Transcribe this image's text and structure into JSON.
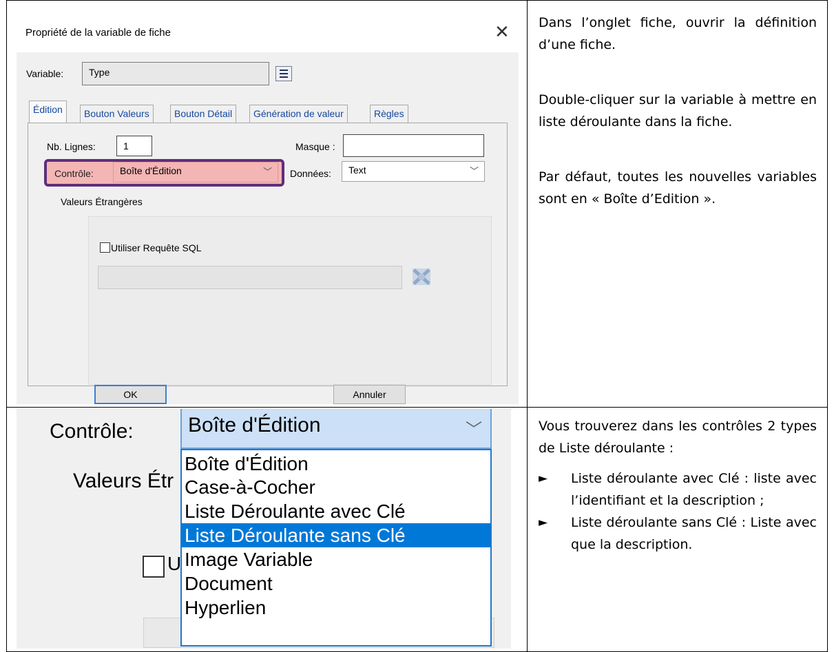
{
  "dialog": {
    "title": "Propriété de la variable de fiche",
    "close_icon": "close-icon",
    "variable_label": "Variable:",
    "variable_value": "Type",
    "tabs": [
      {
        "label": "Édition",
        "active": true
      },
      {
        "label": "Bouton Valeurs"
      },
      {
        "label": "Bouton Détail"
      },
      {
        "label": "Génération de valeur"
      },
      {
        "label": "Règles"
      }
    ],
    "nb_lignes_label": "Nb. Lignes:",
    "nb_lignes_value": "1",
    "masque_label": "Masque :",
    "masque_value": "",
    "controle_label": "Contrôle:",
    "controle_value": "Boîte d'Édition",
    "donnees_label": "Données:",
    "donnees_value": "Text",
    "valeurs_etrangeres_label": "Valeurs Étrangères",
    "utiliser_sql_label": "Utiliser Requête SQL",
    "ok_label": "OK",
    "annuler_label": "Annuler",
    "highlight_color": "#5f2e7a",
    "controle_highlight_color": "#f4b5b5"
  },
  "instructions": {
    "p1": "Dans l’onglet fiche, ouvrir la définition d’une fiche.",
    "p2": "Double-cliquer sur la variable à mettre en liste déroulante dans la fiche.",
    "p3": "Par défaut, toutes les nouvelles variables sont en « Boîte d’Edition ».",
    "p4": "Vous trouverez dans les contrôles 2 types de Liste déroulante :",
    "bullets": [
      "Liste déroulante avec Clé : liste avec l’identifiant et la description ;",
      "Liste déroulante sans Clé : Liste avec que la description."
    ],
    "bullet_glyph": "►"
  },
  "dropdown": {
    "label": "Contrôle:",
    "selected": "Boîte d'Édition",
    "partial_label": "Valeurs Étr",
    "partial_check_label": "U",
    "options": [
      "Boîte d'Édition",
      "Case-à-Cocher",
      "Liste Déroulante avec Clé",
      "Liste Déroulante sans Clé",
      "Image Variable",
      "Document",
      "Hyperlien"
    ],
    "highlighted_option": "Liste Déroulante sans Clé",
    "highlight_color": "#0078d7"
  }
}
